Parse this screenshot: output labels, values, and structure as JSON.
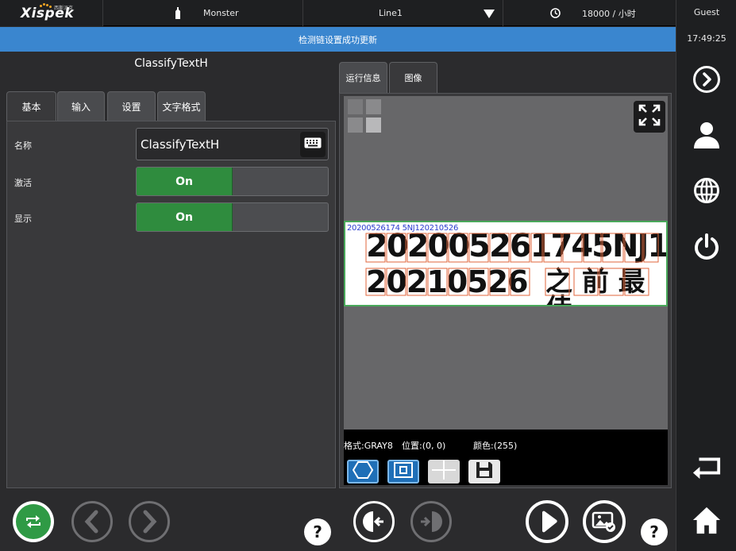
{
  "header": {
    "logo": "Xispek",
    "logo_sub": "西斯派克",
    "product_icon": "bottle-icon",
    "product": "Monster",
    "line": "Line1",
    "speed_icon": "clock-icon",
    "speed": "18000 / 小时"
  },
  "notification": "检测链设置成功更新",
  "sidebar": {
    "user": "Guest",
    "time": "17:49:25",
    "icons": [
      "chevron-right-circle-icon",
      "user-icon",
      "globe-icon",
      "power-icon",
      "back-arrow-icon",
      "home-icon"
    ]
  },
  "left_panel": {
    "title": "ClassifyTextH",
    "tabs": [
      {
        "label": "基本",
        "active": true
      },
      {
        "label": "输入",
        "active": false
      },
      {
        "label": "设置",
        "active": false
      },
      {
        "label": "文字格式",
        "active": false
      }
    ],
    "fields": {
      "name_label": "名称",
      "name_value": "ClassifyTextH",
      "active_label": "激活",
      "active_value": "On",
      "display_label": "显示",
      "display_value": "On"
    }
  },
  "right_panel": {
    "tabs": [
      {
        "label": "运行信息",
        "active": false
      },
      {
        "label": "图像",
        "active": true
      }
    ],
    "ocr": {
      "small_text": "20200526174 5NJ120210526",
      "line1": "202005261745NJ1",
      "line2": "20210526",
      "line2_cjk": "之 前 最 佳"
    },
    "info": {
      "format": "格式:GRAY8",
      "position": "位置:(0, 0)",
      "color": "颜色:(255)"
    },
    "tools": [
      "hexagon-shape-icon",
      "roi-select-icon",
      "crosshair-icon",
      "save-icon"
    ]
  },
  "bottom": {
    "buttons": [
      "refresh-icon",
      "prev-icon",
      "next-icon",
      "help-icon",
      "step-back-icon",
      "step-forward-icon",
      "play-icon",
      "image-capture-icon",
      "help-icon"
    ],
    "help_label": "?"
  }
}
